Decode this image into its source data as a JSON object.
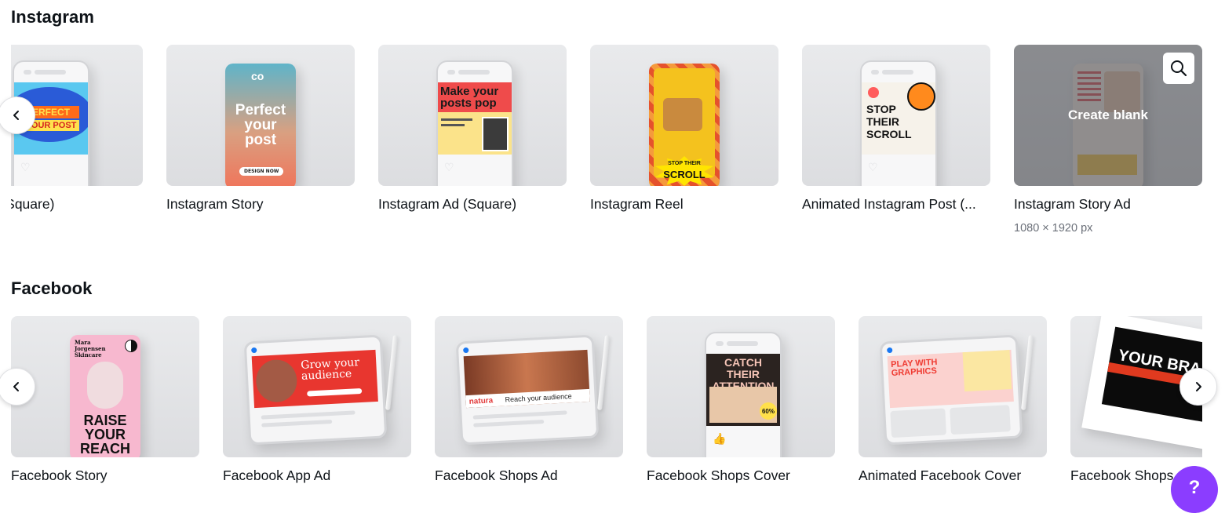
{
  "instagram": {
    "title": "Instagram",
    "cards": [
      {
        "title": "m Post (Square)",
        "thumb_text": [
          "ERFECT",
          "YOUR POST"
        ]
      },
      {
        "title": "Instagram Story",
        "thumb_text": [
          "Perfect your post",
          "DESIGN NOW"
        ]
      },
      {
        "title": "Instagram Ad (Square)",
        "thumb_text": [
          "Make your posts pop"
        ]
      },
      {
        "title": "Instagram Reel",
        "thumb_text": [
          "STOP THEIR",
          "SCROLL"
        ]
      },
      {
        "title": "Animated Instagram Post (...",
        "thumb_text": [
          "STOP THEIR SCROLL"
        ]
      },
      {
        "title": "Instagram Story Ad",
        "subtitle": "1080 × 1920 px",
        "overlay_label": "Create blank"
      }
    ]
  },
  "facebook": {
    "title": "Facebook",
    "cards": [
      {
        "title": "Facebook Story",
        "thumb_text": [
          "Mara Jorgensen Skincare",
          "RAISE YOUR REACH"
        ]
      },
      {
        "title": "Facebook App Ad",
        "thumb_text": [
          "Grow your audience"
        ]
      },
      {
        "title": "Facebook Shops Ad",
        "thumb_text": [
          "natura",
          "Reach your audience"
        ]
      },
      {
        "title": "Facebook Shops Cover",
        "thumb_text": [
          "CATCH THEIR ATTENTION",
          "60%"
        ]
      },
      {
        "title": "Animated Facebook Cover",
        "thumb_text": [
          "PLAY WITH GRAPHICS"
        ]
      },
      {
        "title": "Facebook Shops",
        "thumb_text": [
          "YOUR BRA"
        ]
      }
    ]
  },
  "help": {
    "label": "?"
  },
  "icons": {
    "prev": "chevron-left-icon",
    "next": "chevron-right-icon",
    "search": "search-icon",
    "heart": "heart-icon"
  },
  "colors": {
    "accent": "#8b3dff",
    "text": "#0e1318",
    "muted": "#6b7079"
  }
}
